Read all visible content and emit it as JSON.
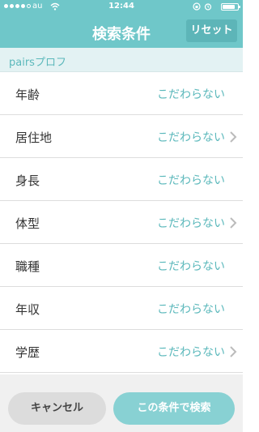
{
  "status_bar": {
    "carrier": "au",
    "time": "12:44",
    "signal_bars": 5,
    "signal_filled": 4,
    "icons": [
      "wifi-icon",
      "rotation-lock-icon",
      "alarm-icon",
      "battery-icon"
    ]
  },
  "header": {
    "title": "検索条件",
    "reset_label": "リセット",
    "color": "#6fc7c9"
  },
  "section": {
    "title": "pairsプロフ"
  },
  "criteria": [
    {
      "label": "年齢",
      "value": "こだわらない",
      "chevron": false
    },
    {
      "label": "居住地",
      "value": "こだわらない",
      "chevron": true
    },
    {
      "label": "身長",
      "value": "こだわらない",
      "chevron": false
    },
    {
      "label": "体型",
      "value": "こだわらない",
      "chevron": true
    },
    {
      "label": "職種",
      "value": "こだわらない",
      "chevron": false
    },
    {
      "label": "年収",
      "value": "こだわらない",
      "chevron": false
    },
    {
      "label": "学歴",
      "value": "こだわらない",
      "chevron": true
    }
  ],
  "footer": {
    "cancel_label": "キャンセル",
    "search_label": "この条件で検索"
  }
}
